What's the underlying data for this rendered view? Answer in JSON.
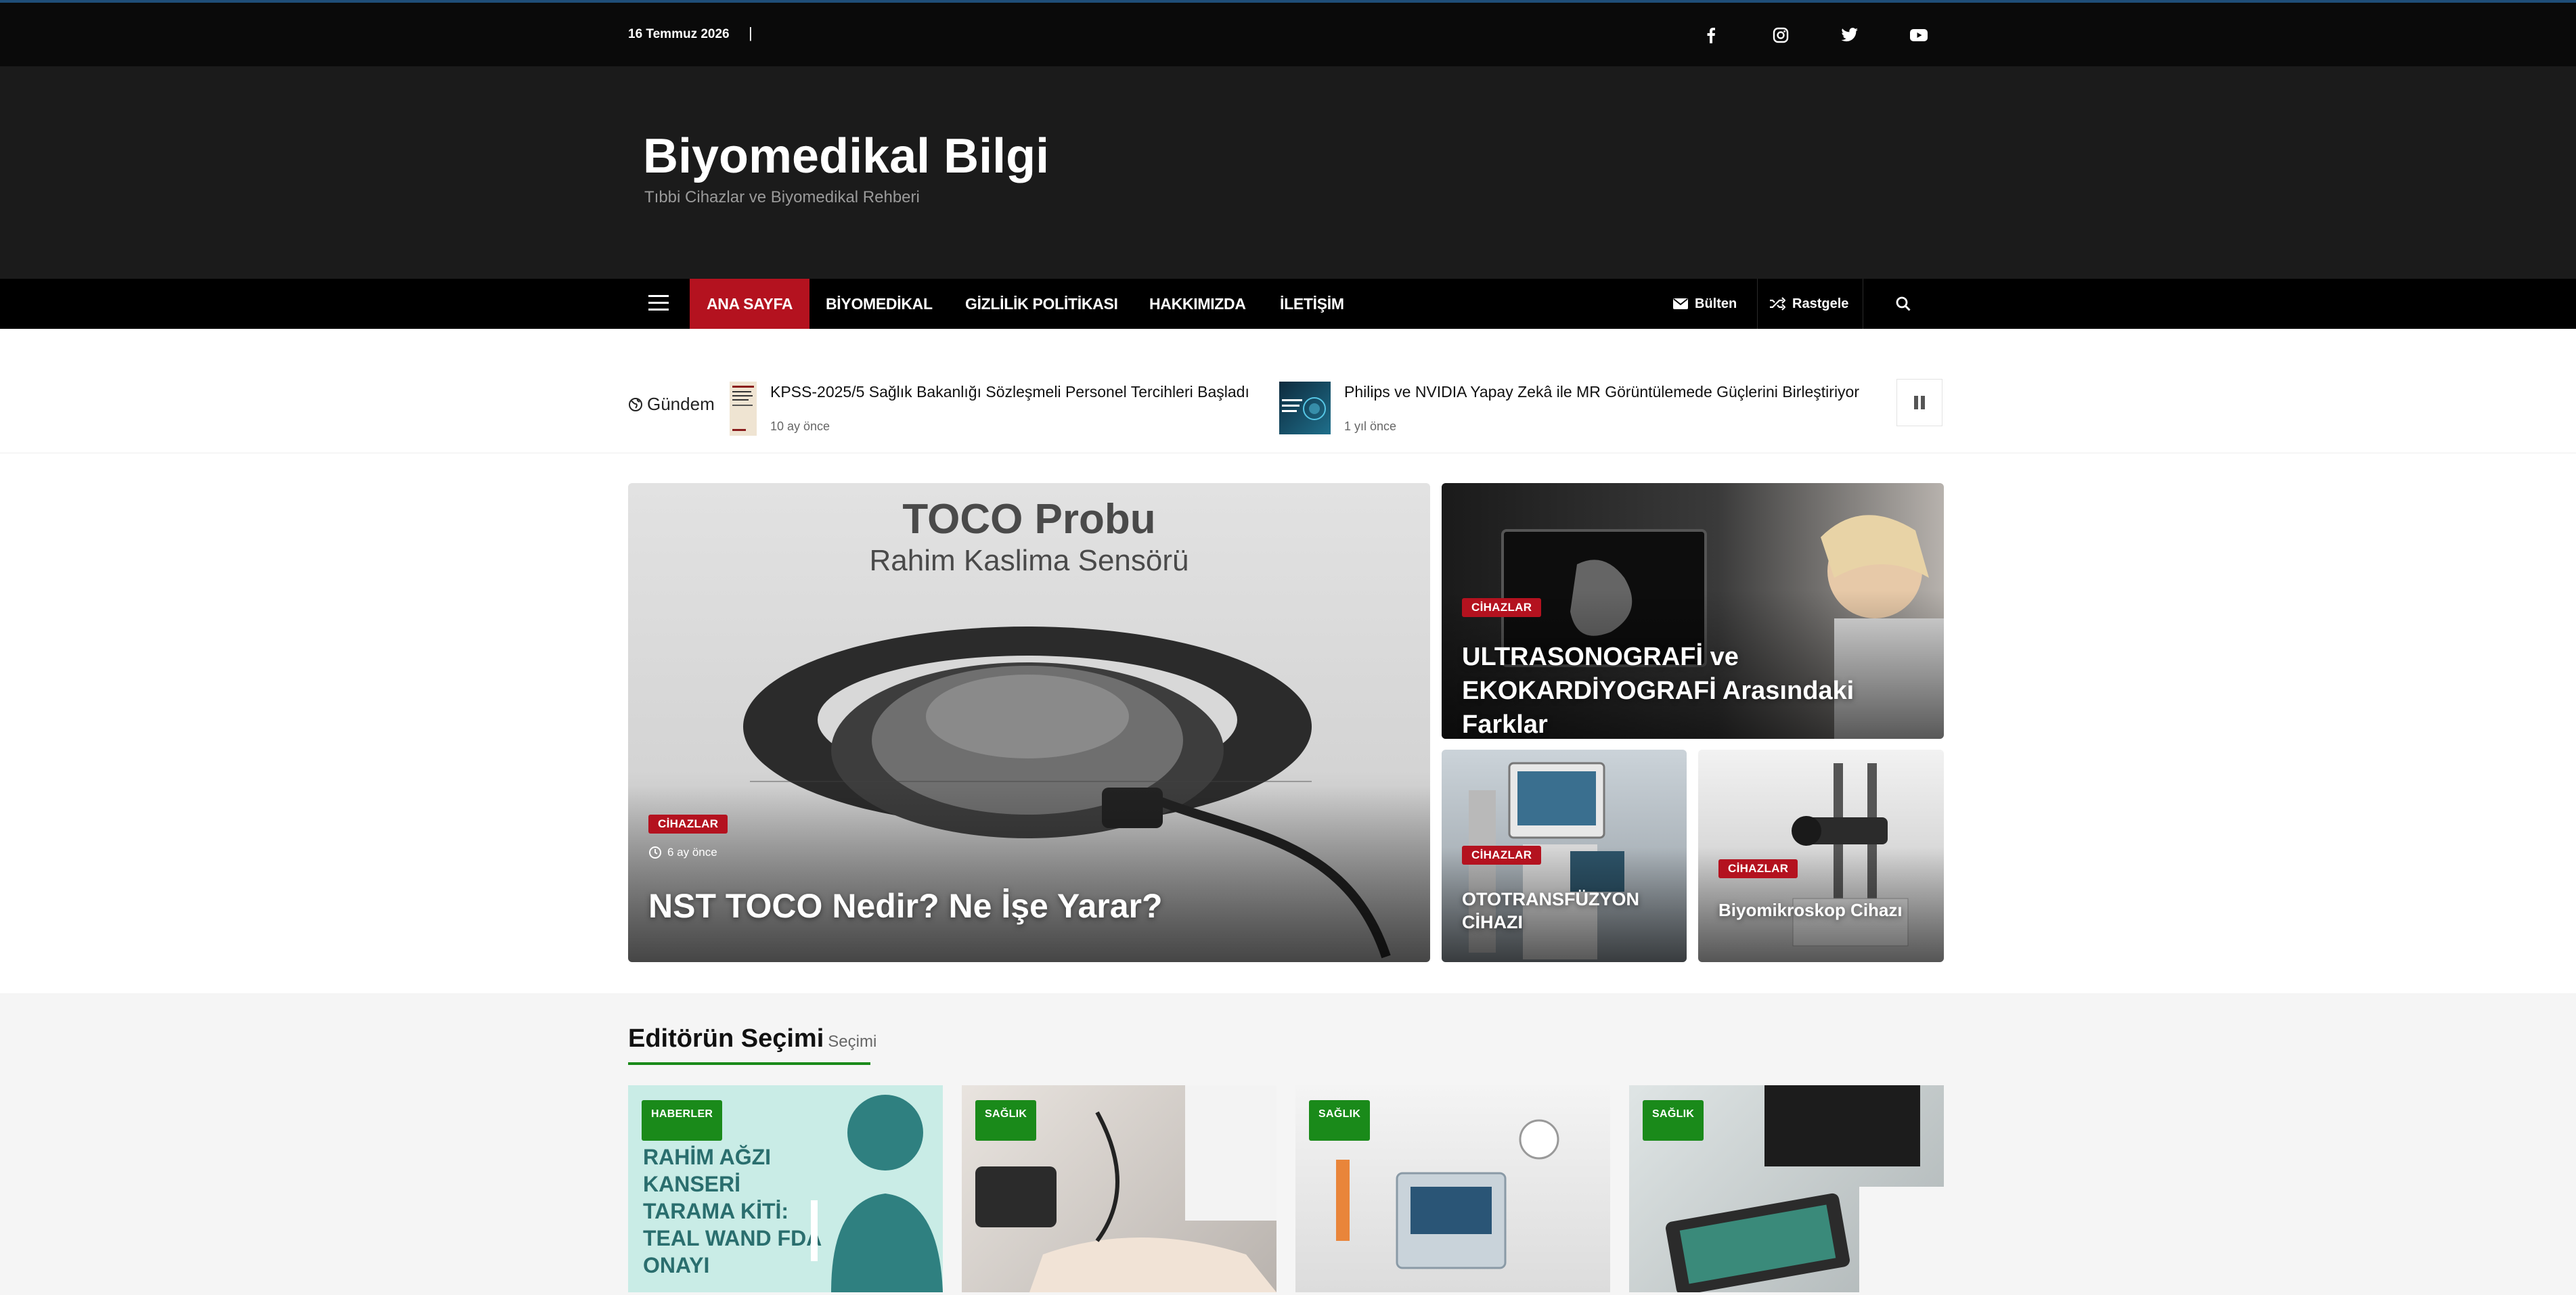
{
  "topbar": {
    "date": "16 Temmuz 2026",
    "separator": "|",
    "social": [
      "facebook-icon",
      "instagram-icon",
      "twitter-icon",
      "youtube-icon"
    ]
  },
  "header": {
    "site_title": "Biyomedikal Bilgi",
    "tagline": "Tıbbi Cihazlar ve Biyomedikal Rehberi"
  },
  "nav": {
    "items": [
      "ANA SAYFA",
      "BİYOMEDİKAL",
      "GİZLİLİK POLİTİKASI",
      "HAKKIMIZDA",
      "İLETİŞİM"
    ],
    "newsletter": "Bülten",
    "random": "Rastgele"
  },
  "ticker": {
    "label": "Gündem",
    "items": [
      {
        "title": "KPSS-2025/5 Sağlık Bakanlığı Sözleşmeli Personel Tercihleri Başladı",
        "time": "10 ay önce"
      },
      {
        "title": "Philips ve NVIDIA Yapay Zekâ ile MR Görüntülemede Güçlerini Birleştiriyor",
        "time": "1 yıl önce"
      }
    ]
  },
  "featured": {
    "main": {
      "category": "CİHAZLAR",
      "time": "6 ay önce",
      "title": "NST TOCO Nedir? Ne İşe Yarar?",
      "image_heading": "TOCO Probu",
      "image_subheading": "Rahim Kaslima Sensörü"
    },
    "top_right": {
      "category": "CİHAZLAR",
      "title": "ULTRASONOGRAFİ ve EKOKARDİYOGRAFİ Arasındaki Farklar"
    },
    "bottom_left": {
      "category": "CİHAZLAR",
      "title": "OTOTRANSFÜZYON CİHAZI"
    },
    "bottom_right": {
      "category": "CİHAZLAR",
      "title": "Biyomikroskop Cihazı"
    }
  },
  "editors": {
    "heading": "Editörün Seçimi",
    "sub": "Seçimi",
    "cards": [
      {
        "category": "HABERLER",
        "image_text": "RAHİM AĞZI KANSERİ TARAMA KİTİ: TEAL WAND FDA ONAYI"
      },
      {
        "category": "SAĞLIK"
      },
      {
        "category": "SAĞLIK"
      },
      {
        "category": "SAĞLIK"
      }
    ]
  },
  "colors": {
    "accent_red": "#b4121f",
    "accent_green": "#1a8a1a",
    "header_bg": "#1b1b1b",
    "topbar_bg": "#0a0a0a"
  }
}
